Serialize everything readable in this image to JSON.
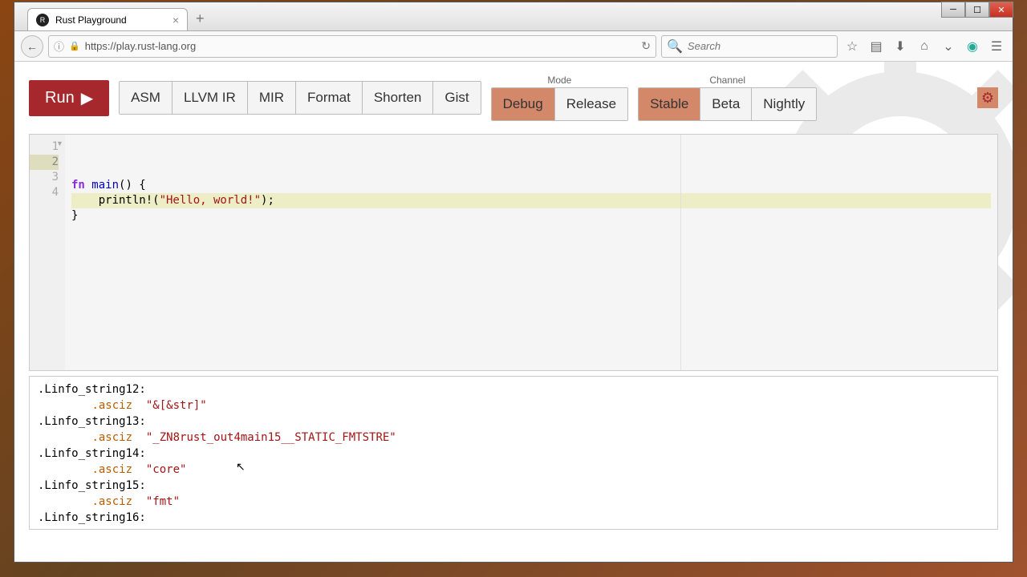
{
  "window": {
    "tab_title": "Rust Playground",
    "url": "https://play.rust-lang.org",
    "search_placeholder": "Search"
  },
  "toolbar": {
    "run": "Run",
    "buttons": [
      "ASM",
      "LLVM IR",
      "MIR",
      "Format",
      "Shorten",
      "Gist"
    ],
    "mode_label": "Mode",
    "mode_options": [
      "Debug",
      "Release"
    ],
    "mode_active": "Debug",
    "channel_label": "Channel",
    "channel_options": [
      "Stable",
      "Beta",
      "Nightly"
    ],
    "channel_active": "Stable"
  },
  "editor": {
    "lines": [
      {
        "n": "1",
        "tokens": [
          {
            "t": "fn ",
            "c": "kw"
          },
          {
            "t": "main",
            "c": "fn-name"
          },
          {
            "t": "() {",
            "c": ""
          }
        ]
      },
      {
        "n": "2",
        "tokens": [
          {
            "t": "    println!(",
            "c": ""
          },
          {
            "t": "\"Hello, world!\"",
            "c": "str"
          },
          {
            "t": ");",
            "c": ""
          }
        ],
        "active": true
      },
      {
        "n": "3",
        "tokens": [
          {
            "t": "}",
            "c": ""
          }
        ]
      },
      {
        "n": "4",
        "tokens": []
      }
    ]
  },
  "output": [
    {
      "label": ".Linfo_string12:",
      "indent": 0
    },
    {
      "directive": ".asciz",
      "str": "\"&[&str]\"",
      "indent": 1
    },
    {
      "label": ".Linfo_string13:",
      "indent": 0
    },
    {
      "directive": ".asciz",
      "str": "\"_ZN8rust_out4main15__STATIC_FMTSTRE\"",
      "indent": 1
    },
    {
      "label": ".Linfo_string14:",
      "indent": 0
    },
    {
      "directive": ".asciz",
      "str": "\"core\"",
      "indent": 1
    },
    {
      "label": ".Linfo_string15:",
      "indent": 0
    },
    {
      "directive": ".asciz",
      "str": "\"fmt\"",
      "indent": 1
    },
    {
      "label": ".Linfo_string16:",
      "indent": 0
    }
  ]
}
